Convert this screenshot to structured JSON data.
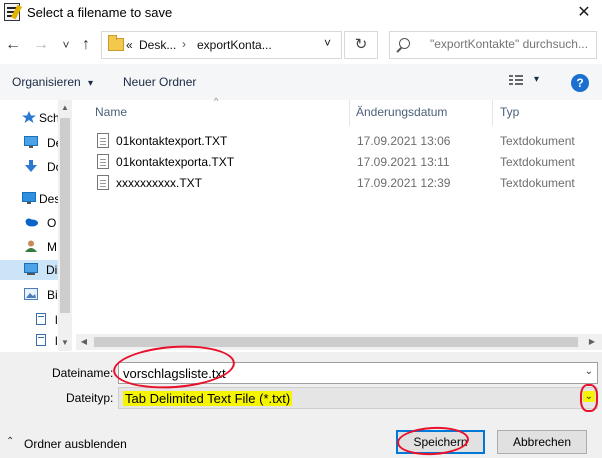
{
  "window": {
    "title": "Select a filename to save",
    "close_glyph": "✕"
  },
  "nav": {
    "back_glyph": "←",
    "forward_glyph": "→",
    "recent_glyph": "˅",
    "up_glyph": "↑",
    "breadcrumb": {
      "overflow": "«",
      "item1": "Desk...",
      "sep": "›",
      "item2": "exportKonta...",
      "dropdown": "˅"
    },
    "refresh_glyph": "↻",
    "search_placeholder": "\"exportKontakte\" durchsuch..."
  },
  "toolbar": {
    "organize_label": "Organisieren",
    "organize_caret": "▾",
    "new_folder_label": "Neuer Ordner",
    "view_caret": "▾",
    "help_label": "?"
  },
  "sidebar": {
    "items": [
      {
        "label": "Sch",
        "icon": "quick-access-icon"
      },
      {
        "label": "De",
        "icon": "desktop-icon"
      },
      {
        "label": "Do",
        "icon": "download-icon"
      },
      {
        "label": "Des",
        "icon": "desktop-icon"
      },
      {
        "label": "O",
        "icon": "onedrive-icon"
      },
      {
        "label": "M",
        "icon": "user-icon"
      },
      {
        "label": "Di",
        "icon": "this-pc-icon"
      },
      {
        "label": "Bi",
        "icon": "pictures-icon"
      },
      {
        "label": "l",
        "icon": "document-icon"
      },
      {
        "label": "l",
        "icon": "document-icon"
      }
    ],
    "scroll_up": "▲",
    "scroll_down": "▼"
  },
  "columns": {
    "name": "Name",
    "date": "Änderungsdatum",
    "type": "Typ",
    "sort_caret": "^"
  },
  "files": [
    {
      "name": "01kontaktexport.TXT",
      "date": "17.09.2021 13:06",
      "type": "Textdokument"
    },
    {
      "name": "01kontaktexporta.TXT",
      "date": "17.09.2021 13:11",
      "type": "Textdokument"
    },
    {
      "name": "xxxxxxxxxx.TXT",
      "date": "17.09.2021 12:39",
      "type": "Textdokument"
    }
  ],
  "hscroll": {
    "left": "◀",
    "right": "▶"
  },
  "form": {
    "filename_label": "Dateiname:",
    "filename_value": "vorschlagsliste.txt",
    "filetype_label": "Dateityp:",
    "filetype_value": "Tab Delimited Text File (*.txt)",
    "combo_caret": "⌄"
  },
  "footer": {
    "hide_folders_label": "Ordner ausblenden",
    "hide_caret": "⌃",
    "save_label": "Speichern",
    "cancel_label": "Abbrechen"
  },
  "colors": {
    "annotation_red": "#e8102a",
    "highlight_yellow": "#f5f500",
    "selection_blue": "#cce4f7",
    "accent_blue": "#0078d7"
  }
}
